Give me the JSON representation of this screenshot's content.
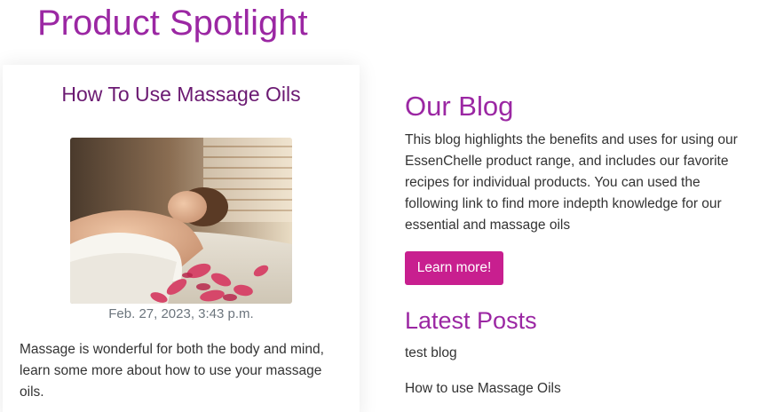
{
  "spotlight": {
    "heading": "Product Spotlight"
  },
  "featured_post": {
    "title": "How To Use Massage Oils",
    "image_alt": "Woman relaxing on a massage table with flower petals",
    "date": "Feb. 27, 2023, 3:43 p.m.",
    "excerpt": "Massage is wonderful for both the body and mind, learn some more about how to use your massage oils."
  },
  "blog": {
    "title": "Our Blog",
    "description": "This blog highlights the benefits and uses for using our EssenChelle product range, and includes our favorite recipes for individual products. You can used the following link to find more indepth knowledge for our essential and massage oils",
    "cta_label": "Learn more!"
  },
  "latest_posts": {
    "title": "Latest Posts",
    "items": [
      {
        "label": "test blog"
      },
      {
        "label": "How to use Massage Oils"
      }
    ]
  },
  "colors": {
    "heading_purple": "#9b27a3",
    "card_title_purple": "#6b1a72",
    "button_magenta": "#c81f8f",
    "body_text": "#333333",
    "muted_text": "#6c757d"
  }
}
